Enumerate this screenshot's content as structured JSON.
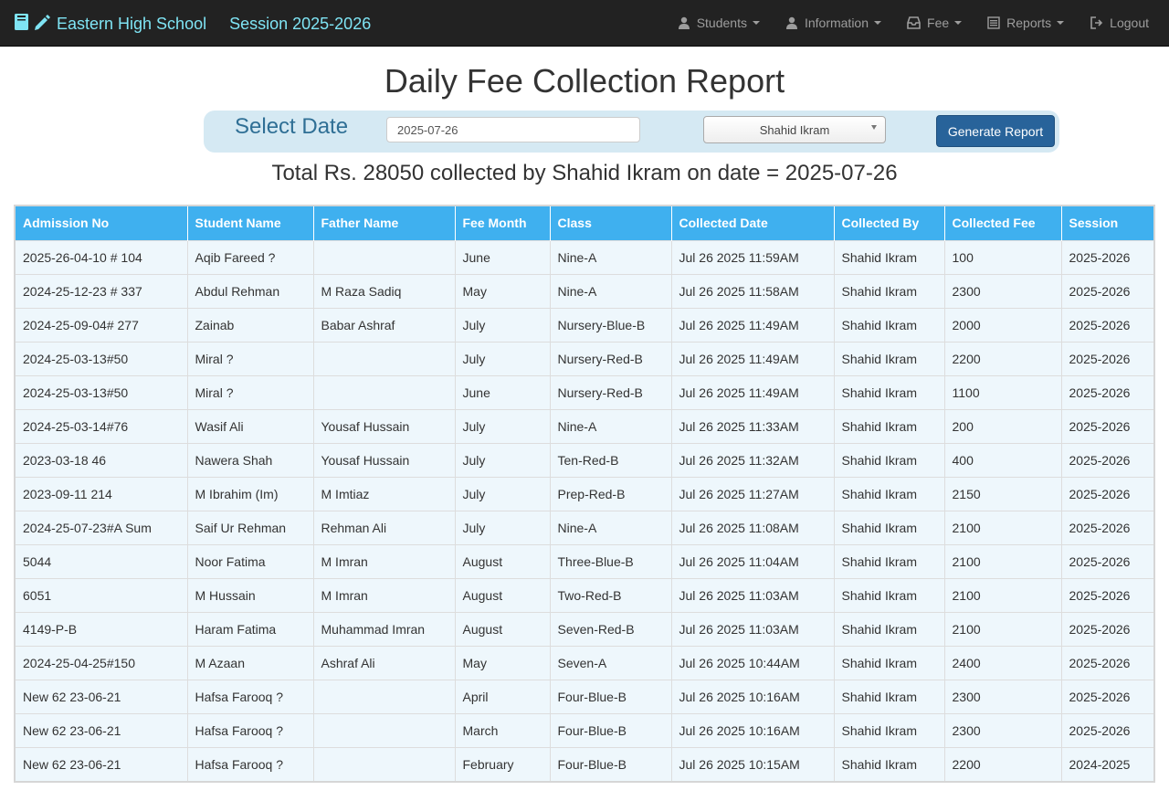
{
  "navbar": {
    "school_name": "Eastern High School",
    "session": "Session 2025-2026",
    "items": [
      {
        "label": "Students",
        "icon": "user-icon"
      },
      {
        "label": "Information",
        "icon": "user-icon"
      },
      {
        "label": "Fee",
        "icon": "inbox-icon"
      },
      {
        "label": "Reports",
        "icon": "list-icon"
      },
      {
        "label": "Logout",
        "icon": "logout-icon"
      }
    ]
  },
  "page": {
    "title": "Daily Fee Collection Report"
  },
  "filter": {
    "label": "Select Date",
    "date_value": "2025-07-26",
    "collector_selected": "Shahid Ikram",
    "generate_label": "Generate Report"
  },
  "summary": "Total Rs. 28050 collected by Shahid Ikram on date = 2025-07-26",
  "table": {
    "headers": [
      "Admission No",
      "Student Name",
      "Father Name",
      "Fee Month",
      "Class",
      "Collected Date",
      "Collected By",
      "Collected Fee",
      "Session"
    ],
    "rows": [
      [
        "2025-26-04-10 # 104",
        "Aqib Fareed ?",
        "",
        "June",
        "Nine-A",
        "Jul 26 2025 11:59AM",
        "Shahid Ikram",
        "100",
        "2025-2026"
      ],
      [
        "2024-25-12-23 # 337",
        "Abdul Rehman",
        "M Raza Sadiq",
        "May",
        "Nine-A",
        "Jul 26 2025 11:58AM",
        "Shahid Ikram",
        "2300",
        "2025-2026"
      ],
      [
        "2024-25-09-04# 277",
        "Zainab",
        "Babar Ashraf",
        "July",
        "Nursery-Blue-B",
        "Jul 26 2025 11:49AM",
        "Shahid Ikram",
        "2000",
        "2025-2026"
      ],
      [
        "2024-25-03-13#50",
        "Miral ?",
        "",
        "July",
        "Nursery-Red-B",
        "Jul 26 2025 11:49AM",
        "Shahid Ikram",
        "2200",
        "2025-2026"
      ],
      [
        "2024-25-03-13#50",
        "Miral ?",
        "",
        "June",
        "Nursery-Red-B",
        "Jul 26 2025 11:49AM",
        "Shahid Ikram",
        "1100",
        "2025-2026"
      ],
      [
        "2024-25-03-14#76",
        "Wasif Ali",
        "Yousaf Hussain",
        "July",
        "Nine-A",
        "Jul 26 2025 11:33AM",
        "Shahid Ikram",
        "200",
        "2025-2026"
      ],
      [
        "2023-03-18 46",
        "Nawera Shah",
        "Yousaf Hussain",
        "July",
        "Ten-Red-B",
        "Jul 26 2025 11:32AM",
        "Shahid Ikram",
        "400",
        "2025-2026"
      ],
      [
        "2023-09-11 214",
        "M Ibrahim (Im)",
        "M Imtiaz",
        "July",
        "Prep-Red-B",
        "Jul 26 2025 11:27AM",
        "Shahid Ikram",
        "2150",
        "2025-2026"
      ],
      [
        "2024-25-07-23#A Sum",
        "Saif Ur Rehman",
        "Rehman Ali",
        "July",
        "Nine-A",
        "Jul 26 2025 11:08AM",
        "Shahid Ikram",
        "2100",
        "2025-2026"
      ],
      [
        "5044",
        "Noor Fatima",
        "M Imran",
        "August",
        "Three-Blue-B",
        "Jul 26 2025 11:04AM",
        "Shahid Ikram",
        "2100",
        "2025-2026"
      ],
      [
        "6051",
        "M Hussain",
        "M Imran",
        "August",
        "Two-Red-B",
        "Jul 26 2025 11:03AM",
        "Shahid Ikram",
        "2100",
        "2025-2026"
      ],
      [
        "4149-P-B",
        "Haram Fatima",
        "Muhammad Imran",
        "August",
        "Seven-Red-B",
        "Jul 26 2025 11:03AM",
        "Shahid Ikram",
        "2100",
        "2025-2026"
      ],
      [
        "2024-25-04-25#150",
        "M Azaan",
        "Ashraf Ali",
        "May",
        "Seven-A",
        "Jul 26 2025 10:44AM",
        "Shahid Ikram",
        "2400",
        "2025-2026"
      ],
      [
        "New 62 23-06-21",
        "Hafsa Farooq ?",
        "",
        "April",
        "Four-Blue-B",
        "Jul 26 2025 10:16AM",
        "Shahid Ikram",
        "2300",
        "2025-2026"
      ],
      [
        "New 62 23-06-21",
        "Hafsa Farooq ?",
        "",
        "March",
        "Four-Blue-B",
        "Jul 26 2025 10:16AM",
        "Shahid Ikram",
        "2300",
        "2025-2026"
      ],
      [
        "New 62 23-06-21",
        "Hafsa Farooq ?",
        "",
        "February",
        "Four-Blue-B",
        "Jul 26 2025 10:15AM",
        "Shahid Ikram",
        "2200",
        "2024-2025"
      ]
    ]
  },
  "colors": {
    "navbar_bg": "#222222",
    "brand": "#7fe4f4",
    "table_header": "#3fb0ef",
    "row_bg": "#eef7fc",
    "button": "#28639a"
  }
}
